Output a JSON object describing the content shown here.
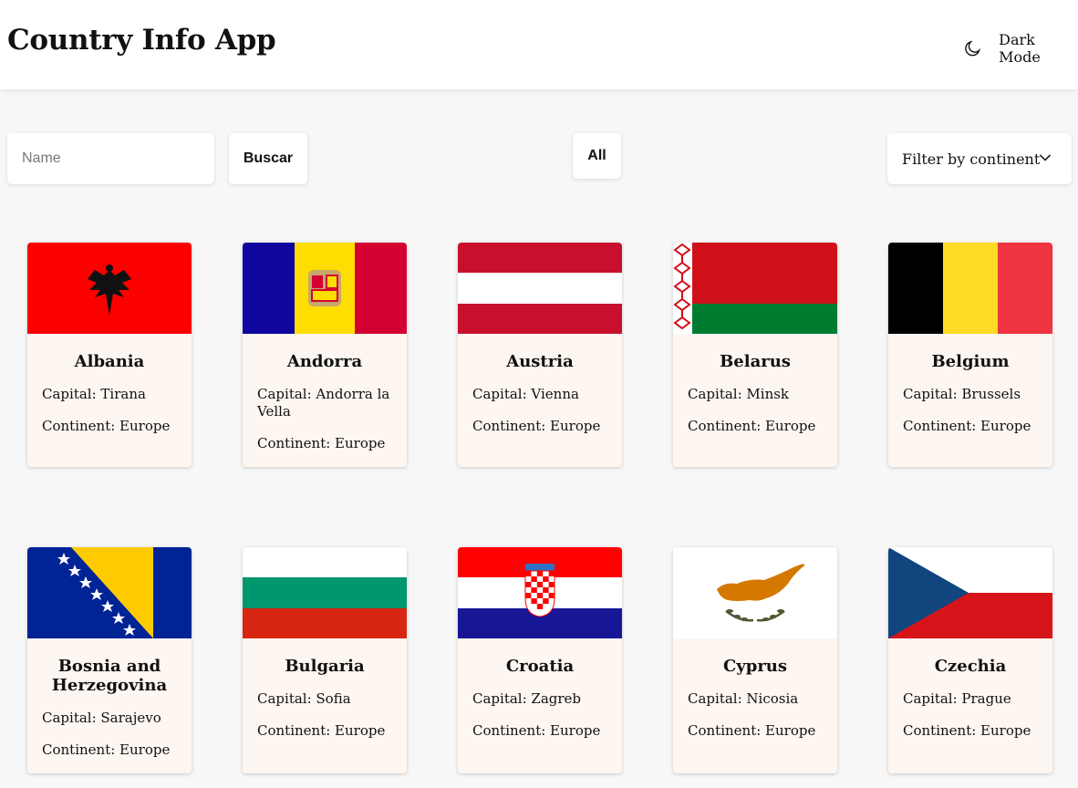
{
  "header": {
    "title": "Country Info App",
    "dark_mode_label": "Dark Mode"
  },
  "controls": {
    "search_placeholder": "Name",
    "search_button": "Buscar",
    "all_button": "All",
    "filter_label": "Filter by continent"
  },
  "countries": [
    {
      "name": "Albania",
      "capital": "Capital: Tirana",
      "continent": "Continent: Europe"
    },
    {
      "name": "Andorra",
      "capital": "Capital: Andorra la Vella",
      "continent": "Continent: Europe"
    },
    {
      "name": "Austria",
      "capital": "Capital: Vienna",
      "continent": "Continent: Europe"
    },
    {
      "name": "Belarus",
      "capital": "Capital: Minsk",
      "continent": "Continent: Europe"
    },
    {
      "name": "Belgium",
      "capital": "Capital: Brussels",
      "continent": "Continent: Europe"
    },
    {
      "name": "Bosnia and Herzegovina",
      "capital": "Capital: Sarajevo",
      "continent": "Continent: Europe"
    },
    {
      "name": "Bulgaria",
      "capital": "Capital: Sofia",
      "continent": "Continent: Europe"
    },
    {
      "name": "Croatia",
      "capital": "Capital: Zagreb",
      "continent": "Continent: Europe"
    },
    {
      "name": "Cyprus",
      "capital": "Capital: Nicosia",
      "continent": "Continent: Europe"
    },
    {
      "name": "Czechia",
      "capital": "Capital: Prague",
      "continent": "Continent: Europe"
    }
  ],
  "colors": {
    "page_bg": "#f7f7f7",
    "card_bg": "#fdf6f1",
    "header_bg": "#ffffff"
  }
}
